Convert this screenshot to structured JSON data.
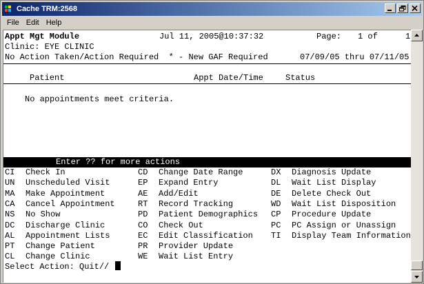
{
  "window": {
    "title": "Cache TRM:2568"
  },
  "menu": [
    "File",
    "Edit",
    "Help"
  ],
  "header": {
    "module": "Appt Mgt Module",
    "datetime": "Jul 11, 2005@10:37:32",
    "page_label": "Page:",
    "page_value": "1 of",
    "page_total": "1"
  },
  "clinic": "Clinic: EYE CLINIC",
  "filter_line": "No Action Taken/Action Required  * - New GAF Required",
  "date_range": "07/09/05 thru 07/11/05",
  "columns": {
    "patient": "Patient",
    "appt": "Appt Date/Time",
    "status": "Status"
  },
  "empty_message": "No appointments meet criteria.",
  "actions_banner": "Enter ?? for more actions",
  "actions": [
    [
      {
        "code": "CI",
        "label": "Check In"
      },
      {
        "code": "CD",
        "label": "Change Date Range"
      },
      {
        "code": "DX",
        "label": "Diagnosis Update"
      }
    ],
    [
      {
        "code": "UN",
        "label": "Unscheduled Visit"
      },
      {
        "code": "EP",
        "label": "Expand Entry"
      },
      {
        "code": "DL",
        "label": "Wait List Display"
      }
    ],
    [
      {
        "code": "MA",
        "label": "Make Appointment"
      },
      {
        "code": "AE",
        "label": "Add/Edit"
      },
      {
        "code": "DE",
        "label": "Delete Check Out"
      }
    ],
    [
      {
        "code": "CA",
        "label": "Cancel Appointment"
      },
      {
        "code": "RT",
        "label": "Record Tracking"
      },
      {
        "code": "WD",
        "label": "Wait List Disposition"
      }
    ],
    [
      {
        "code": "NS",
        "label": "No Show"
      },
      {
        "code": "PD",
        "label": "Patient Demographics"
      },
      {
        "code": "CP",
        "label": "Procedure Update"
      }
    ],
    [
      {
        "code": "DC",
        "label": "Discharge Clinic"
      },
      {
        "code": "CO",
        "label": "Check Out"
      },
      {
        "code": "PC",
        "label": "PC Assign or Unassign"
      }
    ],
    [
      {
        "code": "AL",
        "label": "Appointment Lists"
      },
      {
        "code": "EC",
        "label": "Edit Classification"
      },
      {
        "code": "TI",
        "label": "Display Team Information"
      }
    ],
    [
      {
        "code": "PT",
        "label": "Change Patient"
      },
      {
        "code": "PR",
        "label": "Provider Update"
      },
      null
    ],
    [
      {
        "code": "CL",
        "label": "Change Clinic"
      },
      {
        "code": "WE",
        "label": "Wait List Entry"
      },
      null
    ]
  ],
  "prompt": "Select Action: Quit//"
}
